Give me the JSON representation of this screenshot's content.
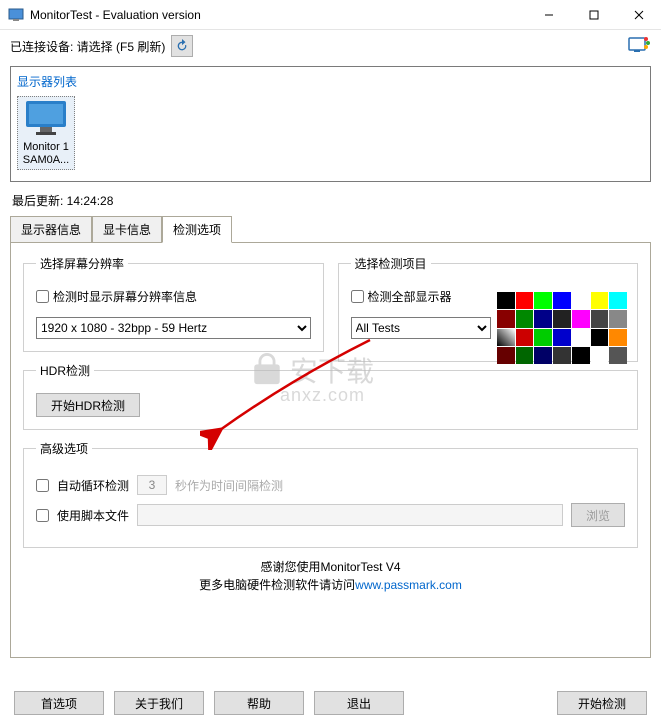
{
  "window": {
    "title": "MonitorTest - Evaluation version"
  },
  "toolbar": {
    "connected_label": "已连接设备: 请选择 (F5 刷新)"
  },
  "monitor_list": {
    "title": "显示器列表",
    "items": [
      {
        "line1": "Monitor 1",
        "line2": "SAM0A..."
      }
    ]
  },
  "status": {
    "last_update": "最后更新:  14:24:28"
  },
  "tabs": {
    "items": [
      {
        "label": "显示器信息"
      },
      {
        "label": "显卡信息"
      },
      {
        "label": "检测选项"
      }
    ],
    "active": 2
  },
  "resolution_group": {
    "legend": "选择屏幕分辨率",
    "show_info_checkbox": "检测时显示屏幕分辨率信息",
    "select_value": "1920 x 1080 - 32bpp - 59 Hertz"
  },
  "test_group": {
    "legend": "选择检测项目",
    "all_monitors_checkbox": "检测全部显示器",
    "select_value": "All Tests"
  },
  "hdr_group": {
    "legend": "HDR检测",
    "button": "开始HDR检测"
  },
  "advanced_group": {
    "legend": "高级选项",
    "auto_loop_checkbox": "自动循环检测",
    "auto_loop_value": "3",
    "seconds_hint": "秒作为时间间隔检测",
    "script_checkbox": "使用脚本文件",
    "browse_button": "浏览"
  },
  "footer": {
    "line1": "感谢您使用MonitorTest V4",
    "line2_a": "更多电脑硬件检测软件请访问",
    "line2_b": "www.passmark.com"
  },
  "buttons": {
    "prefs": "首选项",
    "about": "关于我们",
    "help": "帮助",
    "exit": "退出",
    "start": "开始检测"
  },
  "watermark": {
    "text": "安下载",
    "url": "anxz.com"
  },
  "thumbs": [
    "#000",
    "#f00",
    "#0f0",
    "#00f",
    "#fff",
    "#ff0",
    "#0ff",
    "#800",
    "#080",
    "#008",
    "#222",
    "#f0f",
    "#444",
    "#888",
    "linear-gradient(45deg,#000,#fff)",
    "#c00",
    "#0c0",
    "#00c",
    "#fff",
    "#000",
    "#f80",
    "#600",
    "#060",
    "#006",
    "#333",
    "#000",
    "#fff",
    "#555"
  ]
}
